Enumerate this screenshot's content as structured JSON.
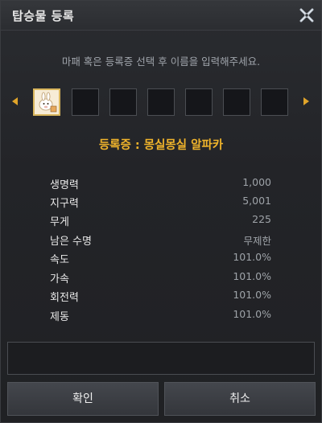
{
  "window": {
    "title": "탑승물 등록"
  },
  "hint": "마패 혹은 등록증 선택 후 이름을 입력해주세요.",
  "slots": {
    "selected_index": 0,
    "count": 7
  },
  "pet_name": "등록증 : 몽실몽실 알파카",
  "stats": [
    {
      "label": "생명력",
      "value": "1,000"
    },
    {
      "label": "지구력",
      "value": "5,001"
    },
    {
      "label": "무게",
      "value": "225"
    },
    {
      "label": "남은 수명",
      "value": "무제한"
    },
    {
      "label": "속도",
      "value": "101.0%"
    },
    {
      "label": "가속",
      "value": "101.0%"
    },
    {
      "label": "회전력",
      "value": "101.0%"
    },
    {
      "label": "제동",
      "value": "101.0%"
    }
  ],
  "name_input": {
    "value": ""
  },
  "buttons": {
    "confirm": "확인",
    "cancel": "취소"
  },
  "colors": {
    "accent": "#f0b42b",
    "arrow": "#e0a42a"
  }
}
